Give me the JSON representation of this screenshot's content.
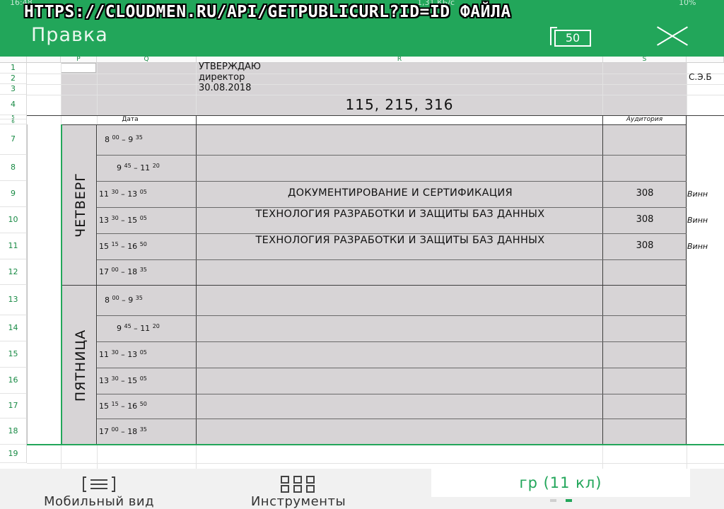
{
  "overlay": {
    "url_text": "HTTPS://CLOUDMEN.RU/API/GETPUBLICURL?ID=ID ФАЙЛА"
  },
  "statusbar": {
    "time": "16:48",
    "speed": "1,31 КБ/с",
    "battery": "10%"
  },
  "appbar": {
    "title": "Правка",
    "pages_count": "50"
  },
  "columns": [
    "P",
    "Q",
    "R",
    "S"
  ],
  "rows": [
    "1",
    "2",
    "3",
    "4",
    "5",
    "6",
    "7",
    "8",
    "9",
    "10",
    "11",
    "12",
    "13",
    "14",
    "15",
    "16",
    "17",
    "18",
    "19"
  ],
  "header": {
    "approve": "УТВЕРЖДАЮ",
    "position": "директор",
    "date": "30.08.2018",
    "groups": "115, 215, 316",
    "director_initials": "С.Э.Б",
    "col_date": "Дата",
    "col_room": "Аудитория"
  },
  "days": [
    {
      "name": "ЧЕТВЕРГ",
      "slots": [
        {
          "start_h": "8",
          "start_m": "00",
          "end_h": "9",
          "end_m": "35",
          "subject": "",
          "room": "",
          "teacher": ""
        },
        {
          "start_h": "9",
          "start_m": "45",
          "end_h": "11",
          "end_m": "20",
          "subject": "",
          "room": "",
          "teacher": ""
        },
        {
          "start_h": "11",
          "start_m": "30",
          "end_h": "13",
          "end_m": "05",
          "subject": "ДОКУМЕНТИРОВАНИЕ И СЕРТИФИКАЦИЯ",
          "room": "308",
          "teacher": "Винн"
        },
        {
          "start_h": "13",
          "start_m": "30",
          "end_h": "15",
          "end_m": "05",
          "subject": "ТЕХНОЛОГИЯ РАЗРАБОТКИ И ЗАЩИТЫ БАЗ ДАННЫХ",
          "room": "308",
          "teacher": "Винн"
        },
        {
          "start_h": "15",
          "start_m": "15",
          "end_h": "16",
          "end_m": "50",
          "subject": "ТЕХНОЛОГИЯ РАЗРАБОТКИ И ЗАЩИТЫ БАЗ ДАННЫХ",
          "room": "308",
          "teacher": "Винн"
        },
        {
          "start_h": "17",
          "start_m": "00",
          "end_h": "18",
          "end_m": "35",
          "subject": "",
          "room": "",
          "teacher": ""
        }
      ]
    },
    {
      "name": "ПЯТНИЦА",
      "slots": [
        {
          "start_h": "8",
          "start_m": "00",
          "end_h": "9",
          "end_m": "35",
          "subject": "",
          "room": "",
          "teacher": ""
        },
        {
          "start_h": "9",
          "start_m": "45",
          "end_h": "11",
          "end_m": "20",
          "subject": "",
          "room": "",
          "teacher": ""
        },
        {
          "start_h": "11",
          "start_m": "30",
          "end_h": "13",
          "end_m": "05",
          "subject": "",
          "room": "",
          "teacher": ""
        },
        {
          "start_h": "13",
          "start_m": "30",
          "end_h": "15",
          "end_m": "05",
          "subject": "",
          "room": "",
          "teacher": ""
        },
        {
          "start_h": "15",
          "start_m": "15",
          "end_h": "16",
          "end_m": "50",
          "subject": "",
          "room": "",
          "teacher": ""
        },
        {
          "start_h": "17",
          "start_m": "00",
          "end_h": "18",
          "end_m": "35",
          "subject": "",
          "room": "",
          "teacher": ""
        }
      ]
    }
  ],
  "bottombar": {
    "mobile_view": "Мобильный вид",
    "tools": "Инструменты",
    "sheet_tab": "гр (11 кл)"
  },
  "colors": {
    "accent": "#22a65a",
    "grey_fill": "#d7d4d6",
    "row_header_text": "#188a44"
  },
  "icons": {
    "close": "close-icon",
    "pages": "pages-icon",
    "mobile_view": "list-view-icon",
    "tools": "grid-icon"
  }
}
